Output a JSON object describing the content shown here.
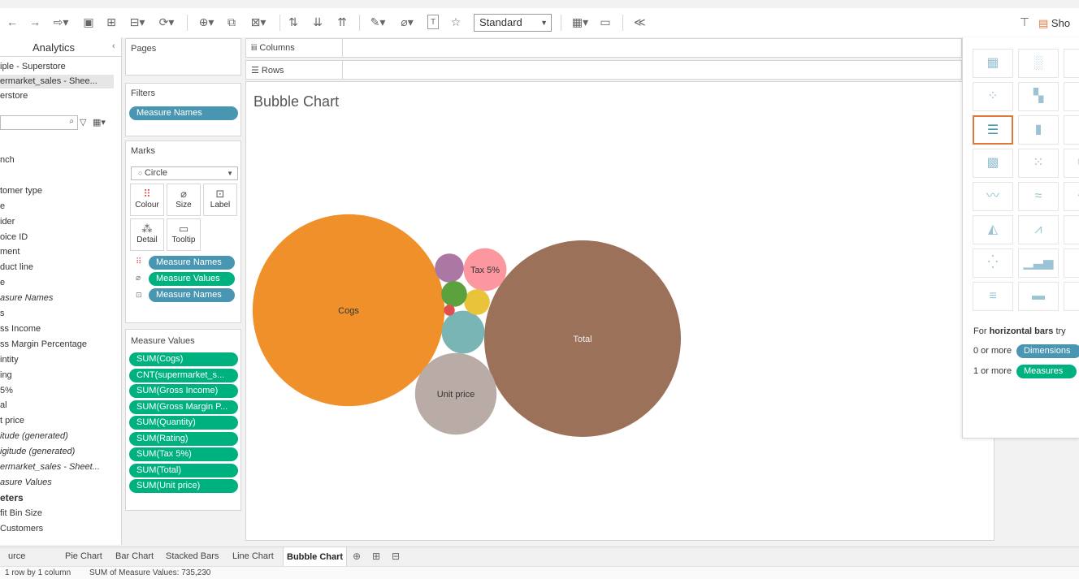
{
  "toolbar": {
    "view_size": "Standard",
    "show_me_label": "Sho"
  },
  "data_pane": {
    "analytics_tab": "Analytics",
    "data_sources": [
      {
        "label": "iple - Superstore",
        "selected": false
      },
      {
        "label": "ermarket_sales - Shee...",
        "selected": true
      },
      {
        "label": "erstore",
        "selected": false
      }
    ],
    "fields": [
      {
        "label": "nch",
        "style": "normal"
      },
      {
        "label": "",
        "style": "normal"
      },
      {
        "label": "tomer type",
        "style": "normal"
      },
      {
        "label": "e",
        "style": "normal"
      },
      {
        "label": "ider",
        "style": "normal"
      },
      {
        "label": "oice ID",
        "style": "normal"
      },
      {
        "label": "ment",
        "style": "normal"
      },
      {
        "label": "duct line",
        "style": "normal"
      },
      {
        "label": "e",
        "style": "normal"
      },
      {
        "label": "asure Names",
        "style": "italic"
      },
      {
        "label": "s",
        "style": "normal"
      },
      {
        "label": "ss Income",
        "style": "normal"
      },
      {
        "label": "ss Margin Percentage",
        "style": "normal"
      },
      {
        "label": "intity",
        "style": "normal"
      },
      {
        "label": "ing",
        "style": "normal"
      },
      {
        "label": "5%",
        "style": "normal"
      },
      {
        "label": "al",
        "style": "normal"
      },
      {
        "label": "t price",
        "style": "normal"
      },
      {
        "label": "itude (generated)",
        "style": "italic"
      },
      {
        "label": "igitude (generated)",
        "style": "italic"
      },
      {
        "label": "ermarket_sales - Sheet...",
        "style": "italic"
      },
      {
        "label": "asure Values",
        "style": "italic"
      },
      {
        "label": "eters",
        "style": "bold"
      },
      {
        "label": "fit Bin Size",
        "style": "normal"
      },
      {
        "label": "Customers",
        "style": "normal"
      }
    ]
  },
  "pages_card": {
    "title": "Pages"
  },
  "filters_card": {
    "title": "Filters",
    "pills": [
      "Measure Names"
    ]
  },
  "marks_card": {
    "title": "Marks",
    "mark_type": "Circle",
    "buttons": [
      {
        "label": "Colour",
        "icon": "colour-icon"
      },
      {
        "label": "Size",
        "icon": "size-icon"
      },
      {
        "label": "Label",
        "icon": "label-icon"
      },
      {
        "label": "Detail",
        "icon": "detail-icon"
      },
      {
        "label": "Tooltip",
        "icon": "tooltip-icon"
      }
    ],
    "encodings": [
      {
        "icon": "colour-icon",
        "field": "Measure Names",
        "color": "blue"
      },
      {
        "icon": "size-icon",
        "field": "Measure Values",
        "color": "green"
      },
      {
        "icon": "label-icon",
        "field": "Measure Names",
        "color": "blue"
      }
    ]
  },
  "measure_values_card": {
    "title": "Measure Values",
    "pills": [
      "SUM(Cogs)",
      "CNT(supermarket_s...",
      "SUM(Gross Income)",
      "SUM(Gross Margin P...",
      "SUM(Quantity)",
      "SUM(Rating)",
      "SUM(Tax 5%)",
      "SUM(Total)",
      "SUM(Unit price)"
    ]
  },
  "shelves": {
    "columns": "Columns",
    "rows": "Rows"
  },
  "view": {
    "title": "Bubble Chart"
  },
  "chart_data": {
    "type": "bubble",
    "title": "Bubble Chart",
    "bubbles": [
      {
        "label": "Total",
        "color": "#9c7159",
        "value": 322967
      },
      {
        "label": "Cogs",
        "color": "#f0902a",
        "value": 307588
      },
      {
        "label": "Unit price",
        "color": "#b9aca6",
        "value": 55673
      },
      {
        "label": "Tax 5%",
        "color": "#fc97a0",
        "value": 15379
      },
      {
        "label": "",
        "color": "#79b5b4",
        "value": 15379
      },
      {
        "label": "",
        "color": "#ab77a3",
        "value": 6973
      },
      {
        "label": "",
        "color": "#e9c43b",
        "value": 5510
      },
      {
        "label": "",
        "color": "#5ba13e",
        "value": 5510
      },
      {
        "label": "",
        "color": "#df4f4b",
        "value": 1000
      }
    ]
  },
  "show_me": {
    "hint_prefix": "For ",
    "hint_bold": "horizontal bars",
    "hint_suffix": " try",
    "req1_prefix": "0 or more",
    "req1_pill": "Dimensions",
    "req2_prefix": "1 or more",
    "req2_pill": "Measures"
  },
  "tabs": [
    "urce",
    "Pie Chart",
    "Bar Chart",
    "Stacked Bars",
    "Line Chart",
    "Bubble Chart"
  ],
  "active_tab": "Bubble Chart",
  "status": {
    "rows_cols": "1 row by 1 column",
    "sum": "SUM of Measure Values: 735,230"
  }
}
